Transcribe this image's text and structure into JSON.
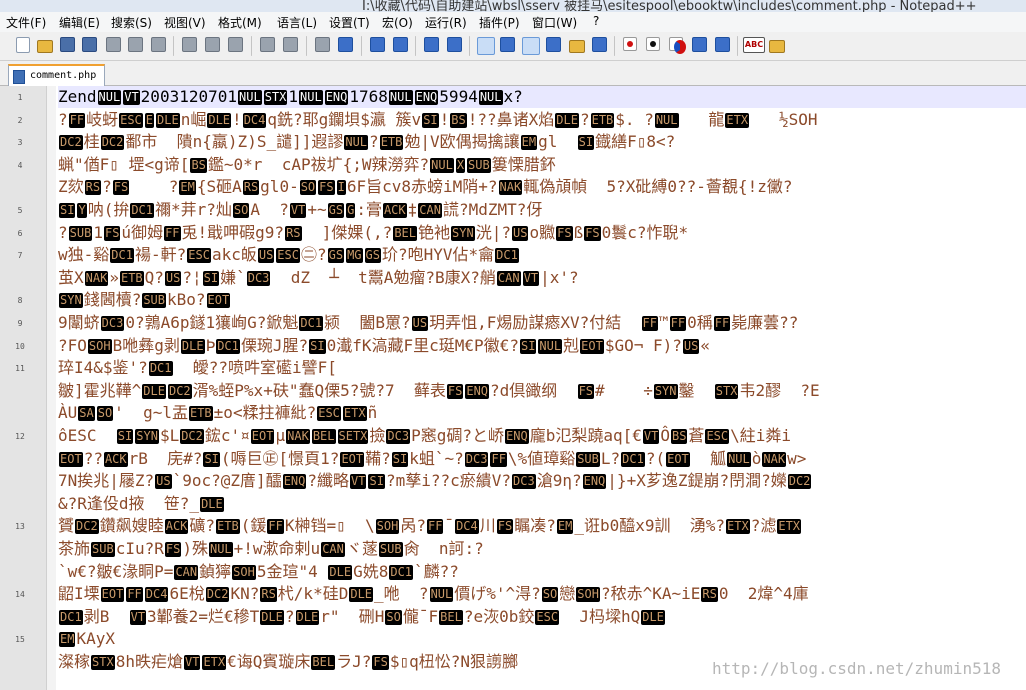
{
  "window": {
    "title": "I:\\收藏\\代码\\自助建站\\wbsl\\sserv 被挂马\\esitespool\\ebooktw\\includes\\comment.php - Notepad++"
  },
  "menu": [
    "文件(F)",
    "编辑(E)",
    "搜索(S)",
    "视图(V)",
    "格式(M)",
    "语言(L)",
    "设置(T)",
    "宏(O)",
    "运行(R)",
    "插件(P)",
    "窗口(W)",
    "?"
  ],
  "tab": {
    "label": "comment.php"
  },
  "line_numbers": [
    "1",
    "2",
    "3",
    "4",
    "5",
    "6",
    "7",
    "8",
    "9",
    "10",
    "11",
    "12",
    "13",
    "14",
    "15"
  ],
  "lines": [
    [
      [
        "t",
        "Zend"
      ],
      [
        "c",
        "NUL"
      ],
      [
        "c",
        "VT"
      ],
      [
        "t",
        "2003120701"
      ],
      [
        "c",
        "NUL"
      ],
      [
        "c",
        "STX"
      ],
      [
        "t",
        "1"
      ],
      [
        "c",
        "NUL"
      ],
      [
        "c",
        "ENQ"
      ],
      [
        "t",
        "1768"
      ],
      [
        "c",
        "NUL"
      ],
      [
        "c",
        "ENQ"
      ],
      [
        "t",
        "5994"
      ],
      [
        "c",
        "NUL"
      ],
      [
        "t",
        "x?"
      ]
    ],
    [
      [
        "t",
        "?"
      ],
      [
        "b",
        "FF"
      ],
      [
        "t",
        "岐蚜"
      ],
      [
        "b",
        "ESC"
      ],
      [
        "b",
        "E"
      ],
      [
        "b",
        "DLE"
      ],
      [
        "t",
        "n崛"
      ],
      [
        "b",
        "DLE"
      ],
      [
        "t",
        "!"
      ],
      [
        "b",
        "DC4"
      ],
      [
        "t",
        "q銑?耶g"
      ],
      [
        "t",
        "鑭垻$瀛 簇v"
      ],
      [
        "b",
        "SI"
      ],
      [
        "t",
        "!"
      ],
      [
        "b",
        "BS"
      ],
      [
        "t",
        "!??鼻诸X焰"
      ],
      [
        "b",
        "DLE"
      ],
      [
        "t",
        "?"
      ],
      [
        "b",
        "ETB"
      ],
      [
        "t",
        "$. ?"
      ],
      [
        "b",
        "NUL"
      ],
      [
        "t",
        "   龍"
      ],
      [
        "b",
        "ETX"
      ],
      [
        "t",
        "   ½SOH"
      ]
    ],
    [
      [
        "b",
        "DC2"
      ],
      [
        "t",
        "桂"
      ],
      [
        "b",
        "DC2"
      ],
      [
        "t",
        "鄱市  隤n{蠃)Z)S_譴]]遐謬"
      ],
      [
        "b",
        "NUL"
      ],
      [
        "t",
        "?"
      ],
      [
        "b",
        "ETB"
      ],
      [
        "t",
        "勉|V欧偶揭擒讓"
      ],
      [
        "b",
        "EM"
      ],
      [
        "t",
        "gl  "
      ],
      [
        "b",
        "SI"
      ],
      [
        "t",
        "鐡繕F▯8<?"
      ]
    ],
    [
      [
        "t",
        "蝋\"偤F▯ 堽<g谛["
      ],
      [
        "b",
        "BS"
      ],
      [
        "t",
        "鑑~0*r  cAP祓圹{;W辣澇弈?"
      ],
      [
        "b",
        "NUL"
      ],
      [
        "b",
        "X"
      ],
      [
        "b",
        "SUB"
      ],
      [
        "t",
        "簍慄腊鈈"
      ]
    ],
    [
      [
        "t",
        "Z欬"
      ],
      [
        "b",
        "RS"
      ],
      [
        "t",
        "?"
      ],
      [
        "b",
        "FS"
      ],
      [
        "t",
        "    ?"
      ],
      [
        "b",
        "EM"
      ],
      [
        "t",
        "{S砸A"
      ],
      [
        "b",
        "RS"
      ],
      [
        "t",
        "gl0-"
      ],
      [
        "b",
        "SO"
      ],
      [
        "b",
        "FS"
      ],
      [
        "b",
        "I"
      ],
      [
        "t",
        "6F旨cv8赤螃iM陗+?"
      ],
      [
        "b",
        "NAK"
      ],
      [
        "t",
        "輒偽頏幀  5?X砒縛0??-薈覩{!z黴?"
      ]
    ],
    [
      [
        "b",
        "SI"
      ],
      [
        "b",
        "Y"
      ],
      [
        "t",
        "呐(拚"
      ],
      [
        "b",
        "DC1"
      ],
      [
        "t",
        "禰*茾r?灿"
      ],
      [
        "b",
        "SO"
      ],
      [
        "t",
        "A  ?"
      ],
      [
        "b",
        "VT"
      ],
      [
        "t",
        "+~"
      ],
      [
        "b",
        "GS"
      ],
      [
        "b",
        "G"
      ],
      [
        "t",
        ":膏"
      ],
      [
        "b",
        "ACK"
      ],
      [
        "t",
        "‡"
      ],
      [
        "b",
        "CAN"
      ],
      [
        "t",
        "謊?MdZMT?伢"
      ]
    ],
    [
      [
        "t",
        "?"
      ],
      [
        "b",
        "SUB"
      ],
      [
        "t",
        "1"
      ],
      [
        "b",
        "FS"
      ],
      [
        "t",
        "ú御姆"
      ],
      [
        "b",
        "FF"
      ],
      [
        "t",
        "兎!戢呷碬g9?"
      ],
      [
        "b",
        "RS"
      ],
      [
        "t",
        "  ]傑婐(,?"
      ],
      [
        "b",
        "BEL"
      ],
      [
        "t",
        "铯衪"
      ],
      [
        "b",
        "SYN"
      ],
      [
        "t",
        "洸|?"
      ],
      [
        "b",
        "US"
      ],
      [
        "t",
        "o覹"
      ],
      [
        "b",
        "FS"
      ],
      [
        "t",
        "ß"
      ],
      [
        "b",
        "FS"
      ],
      [
        "t",
        "0鬟c?怍聣*"
      ]
    ],
    [
      [
        "t",
        "w独-谿"
      ],
      [
        "b",
        "DC1"
      ],
      [
        "t",
        "禓-軒?"
      ],
      [
        "b",
        "ESC"
      ],
      [
        "t",
        "akc皈"
      ],
      [
        "b",
        "US"
      ],
      [
        "b",
        "ESC"
      ],
      [
        "t",
        "㊁?"
      ],
      [
        "b",
        "GS"
      ],
      [
        "b",
        "MG"
      ],
      [
        "b",
        "GS"
      ],
      [
        "t",
        "玠?咆HYV佔*龠"
      ],
      [
        "b",
        "DC1"
      ]
    ],
    [
      [
        "t",
        "茧X"
      ],
      [
        "b",
        "NAK"
      ],
      [
        "t",
        "»"
      ],
      [
        "b",
        "ETB"
      ],
      [
        "t",
        "Q?"
      ],
      [
        "b",
        "US"
      ],
      [
        "t",
        "?¦"
      ],
      [
        "b",
        "SI"
      ],
      [
        "t",
        "嫌`"
      ],
      [
        "b",
        "DC3"
      ],
      [
        "t",
        "  dZ  ┴  t鬻A勉瘤?B康X?艄"
      ],
      [
        "b",
        "CAN"
      ],
      [
        "b",
        "VT"
      ],
      [
        "t",
        "|x'?"
      ]
    ],
    [
      [
        "b",
        "SYN"
      ],
      [
        "t",
        "錢閪櫝?"
      ],
      [
        "b",
        "SUB"
      ],
      [
        "t",
        "kBo?"
      ],
      [
        "b",
        "EOT"
      ]
    ],
    [
      [
        "t",
        "9闈蛴"
      ],
      [
        "b",
        "DC3"
      ],
      [
        "t",
        "0?鶉A6p鐩1獽峋G?鍁魁"
      ],
      [
        "b",
        "DC1"
      ],
      [
        "t",
        "颍  闔B罳?"
      ],
      [
        "b",
        "US"
      ],
      [
        "t",
        "玥弄怚,F焬励謀瘱XV?付結  "
      ],
      [
        "b",
        "FF"
      ],
      [
        "t",
        "™"
      ],
      [
        "b",
        "FF"
      ],
      [
        "t",
        "0稱"
      ],
      [
        "b",
        "FF"
      ],
      [
        "t",
        "毙廉蕓??"
      ]
    ],
    [
      [
        "t",
        "?FO"
      ],
      [
        "b",
        "SOH"
      ],
      [
        "t",
        "B咃彝g剥"
      ],
      [
        "b",
        "DLE"
      ],
      [
        "t",
        "Þ"
      ],
      [
        "b",
        "DC1"
      ],
      [
        "t",
        "傈琬J腥?"
      ],
      [
        "b",
        "SI"
      ],
      [
        "t",
        "0瀐fK滈藏F里c珽M€P徽€?"
      ],
      [
        "b",
        "SI"
      ],
      [
        "b",
        "NUL"
      ],
      [
        "t",
        "剋"
      ],
      [
        "b",
        "EOT"
      ],
      [
        "t",
        "$GO¬ F)?"
      ],
      [
        "b",
        "US"
      ],
      [
        "t",
        "«"
      ]
    ],
    [
      [
        "t",
        "琗I4&$鉴'?"
      ],
      [
        "b",
        "DC1"
      ],
      [
        "t",
        "  皧??喷吽室礷i譬F["
      ]
    ],
    [
      [
        "t",
        "皺]霍兆鞾^"
      ],
      [
        "b",
        "DLE"
      ],
      [
        "b",
        "DC2"
      ],
      [
        "t",
        "湑%蛭P%x+砆\"蠢Q傈5?號?7  藓表"
      ],
      [
        "b",
        "FS"
      ],
      [
        "b",
        "ENQ"
      ],
      [
        "t",
        "?d倶豃纲  "
      ],
      [
        "b",
        "FS"
      ],
      [
        "t",
        "#    ÷"
      ],
      [
        "b",
        "SYN"
      ],
      [
        "t",
        "鑿  "
      ],
      [
        "b",
        "STX"
      ],
      [
        "t",
        "韦2醪  ?E"
      ]
    ],
    [
      [
        "t",
        "ÀU"
      ],
      [
        "b",
        "SA"
      ],
      [
        "b",
        "SO"
      ],
      [
        "t",
        "'  g~l盂"
      ],
      [
        "b",
        "ETB"
      ],
      [
        "t",
        "±o<糅拄褲紕?"
      ],
      [
        "b",
        "ESC"
      ],
      [
        "b",
        "ETX"
      ],
      [
        "t",
        "ñ"
      ]
    ],
    [
      [
        "t",
        "ôESC  "
      ],
      [
        "b",
        "SI"
      ],
      [
        "b",
        "SYN"
      ],
      [
        "t",
        "$L"
      ],
      [
        "b",
        "DC2"
      ],
      [
        "t",
        "鋐c'¤"
      ],
      [
        "b",
        "EOT"
      ],
      [
        "t",
        "μ"
      ],
      [
        "b",
        "NAK"
      ],
      [
        "b",
        "BEL"
      ],
      [
        "b",
        "SETX"
      ],
      [
        "t",
        "撿"
      ],
      [
        "b",
        "DC3"
      ],
      [
        "t",
        "P窸g碉?と峤"
      ],
      [
        "b",
        "ENQ"
      ],
      [
        "t",
        "龐b氾梨蹺aq[€"
      ],
      [
        "b",
        "VT"
      ],
      [
        "t",
        "Ô"
      ],
      [
        "b",
        "BS"
      ],
      [
        "t",
        "蒼"
      ],
      [
        "b",
        "ESC"
      ],
      [
        "t",
        "\\紸i粦i"
      ]
    ],
    [
      [
        "b",
        "EOT"
      ],
      [
        "t",
        "??"
      ],
      [
        "b",
        "ACK"
      ],
      [
        "t",
        "rB  庑#?"
      ],
      [
        "b",
        "SI"
      ],
      [
        "t",
        "(嗕巨㊣[憬頁1?"
      ],
      [
        "b",
        "EOT"
      ],
      [
        "t",
        "鞴?"
      ],
      [
        "b",
        "SI"
      ],
      [
        "t",
        "k蛆`~?"
      ],
      [
        "b",
        "DC3"
      ],
      [
        "b",
        "FF"
      ],
      [
        "t",
        "\\%値璋谿"
      ],
      [
        "b",
        "SUB"
      ],
      [
        "t",
        "L?"
      ],
      [
        "b",
        "DC1"
      ],
      [
        "t",
        "?("
      ],
      [
        "b",
        "EOT"
      ],
      [
        "t",
        "  觚"
      ],
      [
        "b",
        "NUL"
      ],
      [
        "t",
        "ò"
      ],
      [
        "b",
        "NAK"
      ],
      [
        "t",
        "w>"
      ]
    ],
    [
      [
        "t",
        "7N挨兆|屦Z?"
      ],
      [
        "b",
        "US"
      ],
      [
        "t",
        "`9oc?@Z庴]醽"
      ],
      [
        "b",
        "ENQ"
      ],
      [
        "t",
        "?纖略"
      ],
      [
        "b",
        "VT"
      ],
      [
        "b",
        "SI"
      ],
      [
        "t",
        "?m孳i??c瘀繢V?"
      ],
      [
        "b",
        "DC3"
      ],
      [
        "t",
        "滄9η?"
      ],
      [
        "b",
        "ENQ"
      ],
      [
        "t",
        "|}+X芗逸Z鍉崩?閅澗?嬫"
      ],
      [
        "b",
        "DC2"
      ]
    ],
    [
      [
        "t",
        "&?R逢伇d掖  笹?_"
      ],
      [
        "b",
        "DLE"
      ]
    ],
    [
      [
        "t",
        "贇"
      ],
      [
        "b",
        "DC2"
      ],
      [
        "t",
        "鑽飙嫂睦"
      ],
      [
        "b",
        "ACK"
      ],
      [
        "t",
        "礦?"
      ],
      [
        "b",
        "ETB"
      ],
      [
        "t",
        "(鍰"
      ],
      [
        "b",
        "FF"
      ],
      [
        "t",
        "K榊铛=▯  \\"
      ],
      [
        "b",
        "SOH"
      ],
      [
        "t",
        "呙?"
      ],
      [
        "b",
        "FF"
      ],
      [
        "t",
        "¯"
      ],
      [
        "b",
        "DC4"
      ],
      [
        "t",
        "川"
      ],
      [
        "b",
        "FS"
      ],
      [
        "t",
        "瞩凑?"
      ],
      [
        "b",
        "EM"
      ],
      [
        "t",
        "_诳b0醯x9訓  湧%?"
      ],
      [
        "b",
        "ETX"
      ],
      [
        "t",
        "?滤"
      ],
      [
        "b",
        "ETX"
      ]
    ],
    [
      [
        "t",
        "茶斾"
      ],
      [
        "b",
        "SUB"
      ],
      [
        "t",
        "cIu?R"
      ],
      [
        "b",
        "FS"
      ],
      [
        "t",
        ")殊"
      ],
      [
        "b",
        "NUL"
      ],
      [
        "t",
        "+!w漱命剌u"
      ],
      [
        "b",
        "CAN"
      ],
      [
        "t",
        "ヾ蓫"
      ],
      [
        "b",
        "SUB"
      ],
      [
        "t",
        "肏  n訶:?"
      ]
    ],
    [
      [
        "t",
        "`w€?皺€湪眮P="
      ],
      [
        "b",
        "CAN"
      ],
      [
        "t",
        "鍞獰"
      ],
      [
        "b",
        "SOH"
      ],
      [
        "t",
        "5金瑄\"4 "
      ],
      [
        "b",
        "DLE"
      ],
      [
        "t",
        "G姺8"
      ],
      [
        "b",
        "DC1"
      ],
      [
        "t",
        "`麟??"
      ]
    ],
    [
      [
        "t",
        "鼦I塛"
      ],
      [
        "b",
        "EOT"
      ],
      [
        "b",
        "FF"
      ],
      [
        "b",
        "DC4"
      ],
      [
        "t",
        "6E梲"
      ],
      [
        "b",
        "DC2"
      ],
      [
        "t",
        "KN?"
      ],
      [
        "b",
        "RS"
      ],
      [
        "t",
        "杙/k*硅D"
      ],
      [
        "b",
        "DLE"
      ],
      [
        "t",
        "_咃  ?"
      ],
      [
        "b",
        "NUL"
      ],
      [
        "t",
        "價げ%'^淂?"
      ],
      [
        "b",
        "SO"
      ],
      [
        "t",
        "戀"
      ],
      [
        "b",
        "SOH"
      ],
      [
        "t",
        "?秾赤^KA~iE"
      ],
      [
        "b",
        "RS"
      ],
      [
        "t",
        "0  2煒^4庫"
      ]
    ],
    [
      [
        "b",
        "DC1"
      ],
      [
        "t",
        "剥B  "
      ],
      [
        "b",
        "VT"
      ],
      [
        "t",
        "3鄻養2=烂€穇T"
      ],
      [
        "b",
        "DLE"
      ],
      [
        "t",
        "?"
      ],
      [
        "b",
        "DLE"
      ],
      [
        "t",
        "r\"  硎H"
      ],
      [
        "b",
        "SO"
      ],
      [
        "t",
        "儱¯F"
      ],
      [
        "b",
        "BEL"
      ],
      [
        "t",
        "?e洃0b鉸"
      ],
      [
        "b",
        "ESC"
      ],
      [
        "t",
        "  J杩墚hQ"
      ],
      [
        "b",
        "DLE"
      ]
    ],
    [
      [
        "b",
        "EM"
      ],
      [
        "t",
        "KAyX"
      ]
    ],
    [
      [
        "t",
        "澯稼"
      ],
      [
        "b",
        "STX"
      ],
      [
        "t",
        "8h昳疟熗"
      ],
      [
        "b",
        "VT"
      ],
      [
        "b",
        "ETX"
      ],
      [
        "t",
        "€诲Q賓璇床"
      ],
      [
        "b",
        "BEL"
      ],
      [
        "t",
        "ラJ?"
      ],
      [
        "b",
        "FS"
      ],
      [
        "t",
        "$▯q杻忪?N狠謭膷"
      ]
    ]
  ],
  "line_number_rows": [
    0,
    1,
    2,
    3,
    5,
    6,
    7,
    9,
    10,
    11,
    12,
    15,
    19,
    22,
    24
  ],
  "watermark": "http://blog.csdn.net/zhumin518"
}
